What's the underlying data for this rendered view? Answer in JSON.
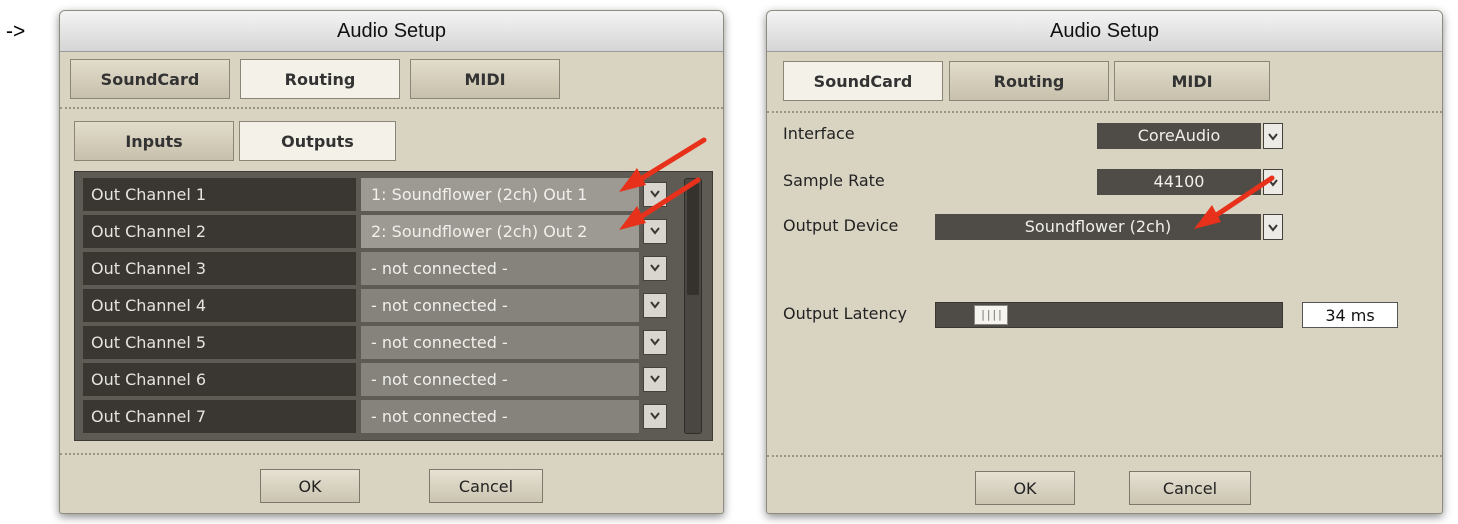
{
  "prefix": "->",
  "routing_window": {
    "title": "Audio Setup",
    "tabs": [
      "SoundCard",
      "Routing",
      "MIDI"
    ],
    "subtabs": [
      "Inputs",
      "Outputs"
    ],
    "rows": [
      {
        "label": "Out Channel 1",
        "value": "1: Soundflower (2ch) Out 1"
      },
      {
        "label": "Out Channel 2",
        "value": "2: Soundflower (2ch) Out 2"
      },
      {
        "label": "Out Channel 3",
        "value": "- not connected -"
      },
      {
        "label": "Out Channel 4",
        "value": "- not connected -"
      },
      {
        "label": "Out Channel 5",
        "value": "- not connected -"
      },
      {
        "label": "Out Channel 6",
        "value": "- not connected -"
      },
      {
        "label": "Out Channel 7",
        "value": "- not connected -"
      }
    ],
    "ok": "OK",
    "cancel": "Cancel"
  },
  "soundcard_window": {
    "title": "Audio Setup",
    "tabs": [
      "SoundCard",
      "Routing",
      "MIDI"
    ],
    "interface_label": "Interface",
    "interface_value": "CoreAudio",
    "sample_rate_label": "Sample Rate",
    "sample_rate_value": "44100",
    "output_device_label": "Output Device",
    "output_device_value": "Soundflower (2ch)",
    "latency_label": "Output Latency",
    "latency_handle_glyph": "||||",
    "latency_value": "34 ms",
    "ok": "OK",
    "cancel": "Cancel"
  },
  "colors": {
    "annotation_arrow": "#e8311a",
    "panel_bg": "#5e5b55",
    "window_bg": "#d9d4c2"
  }
}
